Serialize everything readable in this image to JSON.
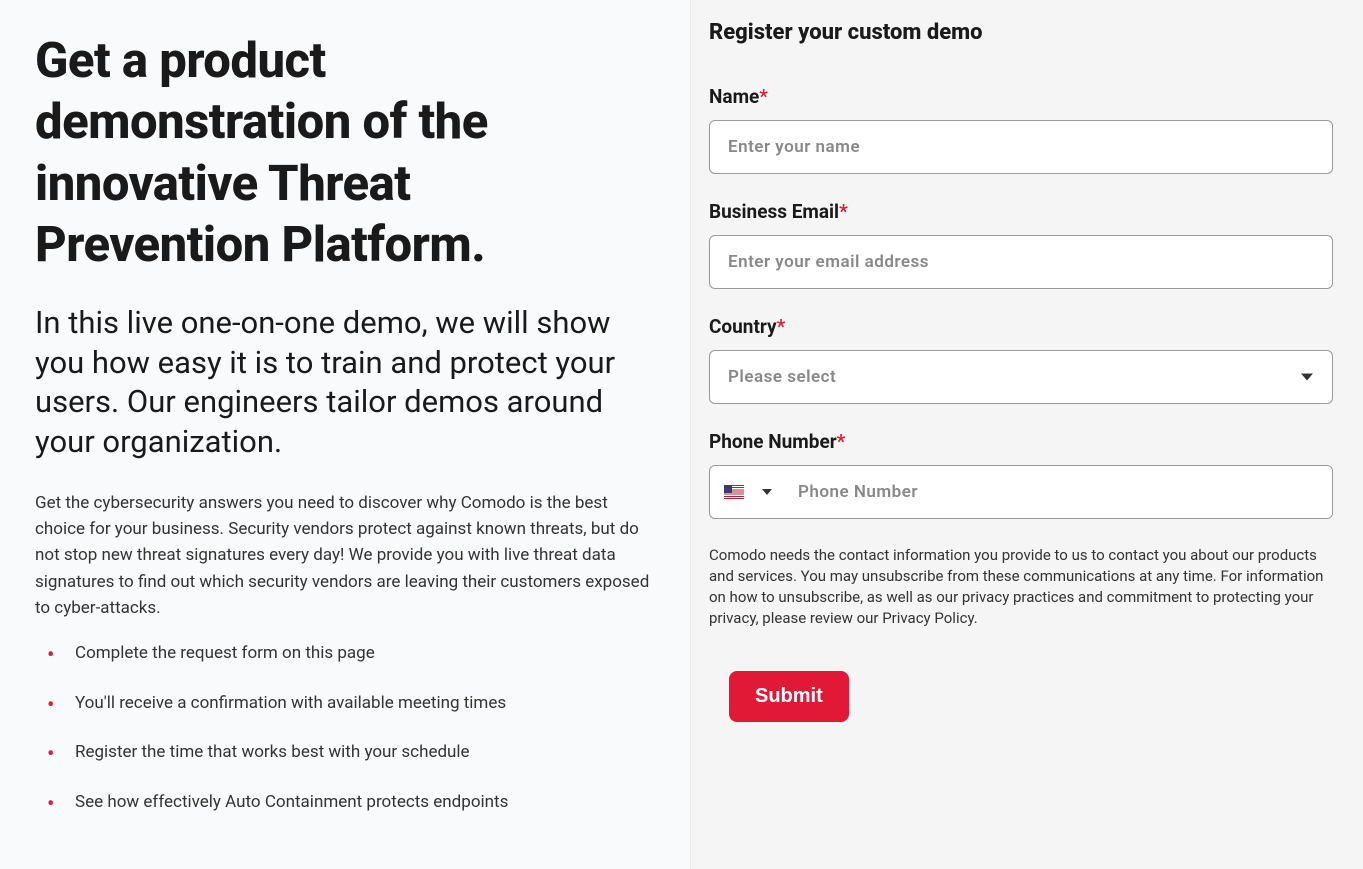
{
  "left": {
    "heading": "Get a product demonstration of the innovative Threat Prevention Platform.",
    "subheading": "In this live one-on-one demo, we will show you how easy it is to train and protect your users. Our engineers tailor demos around your organization.",
    "body": "Get the cybersecurity answers you need to discover why Comodo is the best choice for your business. Security vendors protect against known threats, but do not stop new threat signatures every day! We provide you with live threat data signatures to find out which security vendors are leaving their customers exposed to cyber-attacks.",
    "bullets": [
      "Complete the request form on this page",
      "You'll receive a confirmation with available meeting times",
      "Register the time that works best with your schedule",
      "See how effectively Auto Containment protects endpoints"
    ]
  },
  "form": {
    "title": "Register your custom demo",
    "name_label": "Name",
    "name_placeholder": "Enter your name",
    "email_label": "Business Email",
    "email_placeholder": "Enter your email address",
    "country_label": "Country",
    "country_placeholder": "Please select",
    "phone_label": "Phone Number",
    "phone_placeholder": "Phone Number",
    "privacy_text": "Comodo needs the contact information you provide to us to contact you about our products and services. You may unsubscribe from these communications at any time. For information on how to unsubscribe, as well as our privacy practices and commitment to protecting your privacy, please review our Privacy Policy.",
    "submit_label": "Submit"
  }
}
